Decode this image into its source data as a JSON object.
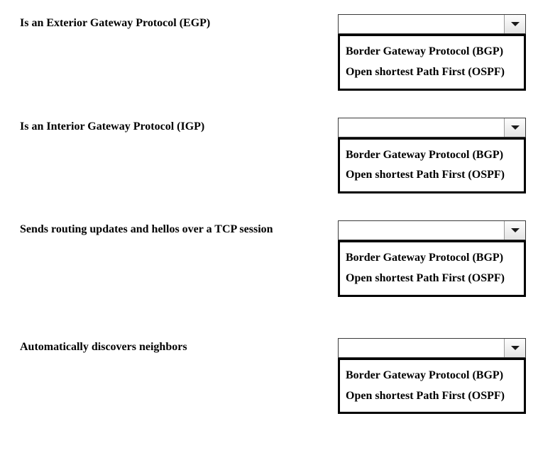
{
  "questions": [
    {
      "prompt": "Is an Exterior Gateway Protocol (EGP)",
      "selected": "",
      "options": [
        "Border Gateway Protocol (BGP)",
        "Open shortest Path First (OSPF)"
      ]
    },
    {
      "prompt": "Is an Interior Gateway Protocol (IGP)",
      "selected": "",
      "options": [
        "Border Gateway Protocol (BGP)",
        "Open shortest Path First (OSPF)"
      ]
    },
    {
      "prompt": "Sends routing updates and hellos over a TCP session",
      "selected": "",
      "options": [
        "Border Gateway Protocol (BGP)",
        "Open shortest Path First (OSPF)"
      ]
    },
    {
      "prompt": "Automatically discovers neighbors",
      "selected": "",
      "options": [
        "Border Gateway Protocol (BGP)",
        "Open shortest Path First (OSPF)"
      ]
    }
  ]
}
